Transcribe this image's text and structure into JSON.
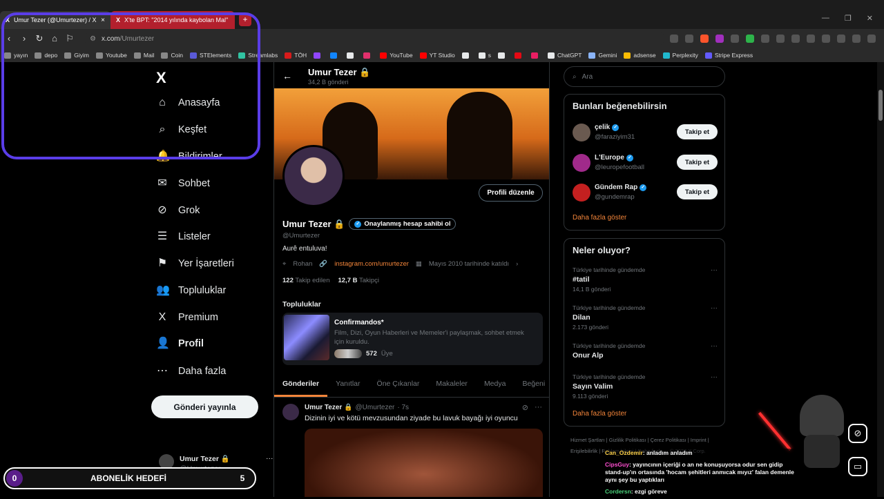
{
  "browser": {
    "tabs": [
      {
        "title": "Umur Tezer (@Umurtezer) / X",
        "close": "×"
      },
      {
        "title": "X'te BPT: \"2014 yılında kaybolan Mal\"",
        "close": "×"
      }
    ],
    "new_tab": "+",
    "window_controls": [
      "—",
      "❐",
      "✕"
    ],
    "url_host": "x.com",
    "url_path": "/Umurtezer",
    "bookmarks": [
      {
        "label": "yayın",
        "color": "#888"
      },
      {
        "label": "depo",
        "color": "#888"
      },
      {
        "label": "Giyim",
        "color": "#888"
      },
      {
        "label": "Youtube",
        "color": "#888"
      },
      {
        "label": "Mail",
        "color": "#888"
      },
      {
        "label": "Coin",
        "color": "#888"
      },
      {
        "label": "STElements",
        "color": "#5a5ad8"
      },
      {
        "label": "Streamlabs",
        "color": "#31c3a2"
      },
      {
        "label": "TÖH",
        "color": "#d81b1b"
      },
      {
        "label": "",
        "color": "#9146ff"
      },
      {
        "label": "",
        "color": "#1185fe"
      },
      {
        "label": "",
        "color": "#e7e9ea"
      },
      {
        "label": "",
        "color": "#e1306c"
      },
      {
        "label": "YouTube",
        "color": "#ff0000"
      },
      {
        "label": "YT Studio",
        "color": "#ff0000"
      },
      {
        "label": "",
        "color": "#e7e9ea"
      },
      {
        "label": "s",
        "color": "#e7e9ea"
      },
      {
        "label": "",
        "color": "#e7e9ea"
      },
      {
        "label": "",
        "color": "#e50914"
      },
      {
        "label": "",
        "color": "#e91e63"
      },
      {
        "label": "ChatGPT",
        "color": "#e7e9ea"
      },
      {
        "label": "Gemini",
        "color": "#8ab4f8"
      },
      {
        "label": "adsense",
        "color": "#fbbc04"
      },
      {
        "label": "Perplexity",
        "color": "#20b8cd"
      },
      {
        "label": "Stripe Express",
        "color": "#635bff"
      }
    ]
  },
  "nav": {
    "logo": "X",
    "items": [
      {
        "label": "Anasayfa",
        "icon": "⌂",
        "bold": false
      },
      {
        "label": "Keşfet",
        "icon": "⌕",
        "bold": false
      },
      {
        "label": "Bildirimler",
        "icon": "🔔",
        "bold": false
      },
      {
        "label": "Sohbet",
        "icon": "✉",
        "bold": false
      },
      {
        "label": "Grok",
        "icon": "⊘",
        "bold": false
      },
      {
        "label": "Listeler",
        "icon": "☰",
        "bold": false
      },
      {
        "label": "Yer İşaretleri",
        "icon": "⚑",
        "bold": false
      },
      {
        "label": "Topluluklar",
        "icon": "👥",
        "bold": false
      },
      {
        "label": "Premium",
        "icon": "X",
        "bold": false
      },
      {
        "label": "Profil",
        "icon": "👤",
        "bold": true
      },
      {
        "label": "Daha fazla",
        "icon": "⋯",
        "bold": false
      }
    ],
    "post_button": "Gönderi yayınla",
    "account_name": "Umur Tezer 🔒",
    "account_handle": "@Umurtezer",
    "account_more": "···"
  },
  "profile": {
    "header_name": "Umur Tezer 🔒",
    "header_count": "34,2 B gönderi",
    "edit_button": "Profili düzenle",
    "name": "Umur Tezer 🔒",
    "verify_label": "Onaylanmış hesap sahibi ol",
    "handle": "@Umurtezer",
    "bio": "Aurê entuluva!",
    "location": "Rohan",
    "link": "instagram.com/umurtezer",
    "joined": "Mayıs 2010 tarihinde katıldı",
    "following_count": "122",
    "following_label": "Takip edilen",
    "followers_count": "12,7 B",
    "followers_label": "Takipçi",
    "communities_title": "Topluluklar",
    "community": {
      "name": "Confirmandos*",
      "description": "Film, Dizi, Oyun Haberleri ve Memeler'i paylaşmak, sohbet etmek için kuruldu.",
      "members_count": "572",
      "members_label": "Üye"
    },
    "tabs": [
      "Gönderiler",
      "Yanıtlar",
      "Öne Çıkanlar",
      "Makaleler",
      "Medya",
      "Beğeni"
    ],
    "tweet": {
      "name": "Umur Tezer 🔒",
      "handle": "@Umurtezer",
      "time": "· 7s",
      "text": "Dizinin iyi ve kötü mevzusundan ziyade bu lavuk bayağı iyi oyuncu",
      "more": "···"
    }
  },
  "sidebar": {
    "search_placeholder": "Ara",
    "who_to_follow_title": "Bunları beğenebilirsin",
    "suggestions": [
      {
        "name": "çelik",
        "handle": "@faraziyim31",
        "button": "Takip et",
        "avatar_color": "#6a5a50"
      },
      {
        "name": "L'Europe",
        "handle": "@leuropefootball",
        "button": "Takip et",
        "avatar_color": "#a02a8a"
      },
      {
        "name": "Gündem Rap",
        "handle": "@gundemrap",
        "button": "Takip et",
        "avatar_color": "#c42020"
      }
    ],
    "show_more": "Daha fazla göster",
    "trends_title": "Neler oluyor?",
    "trends": [
      {
        "context": "Türkiye tarihinde gündemde",
        "topic": "#tatil",
        "count": "14,1 B gönderi"
      },
      {
        "context": "Türkiye tarihinde gündemde",
        "topic": "Dilan",
        "count": "2.173 gönderi"
      },
      {
        "context": "Türkiye tarihinde gündemde",
        "topic": "Onur Alp",
        "count": ""
      },
      {
        "context": "Türkiye tarihinde gündemde",
        "topic": "Sayın Valim",
        "count": "9.113 gönderi"
      }
    ],
    "trends_show_more": "Daha fazla göster",
    "footer": "Hizmet Şartları | Gizlilik Politikası | Çerez Politikası | Imprint | Erişilebilirlik | Reklam bilgisi | Daha fazla ... © 2026 X Corp."
  },
  "overlay": {
    "goal_current": "0",
    "goal_label": "ABONELİK HEDEFİ",
    "goal_target": "5",
    "chat": [
      {
        "user": "Can_Ozdemir",
        "text": ": anladım anladım"
      },
      {
        "user": "CipsGuy",
        "text": ": yayıncının içeriği o an ne konuşuyorsa odur sen gidip stand-up'ın ortasında 'hocam şehitleri anmıcak mıyız' falan demenle aynı şey bu yaptıkları"
      },
      {
        "user": "Cordersn",
        "text": ": ezgi göreve"
      }
    ]
  }
}
